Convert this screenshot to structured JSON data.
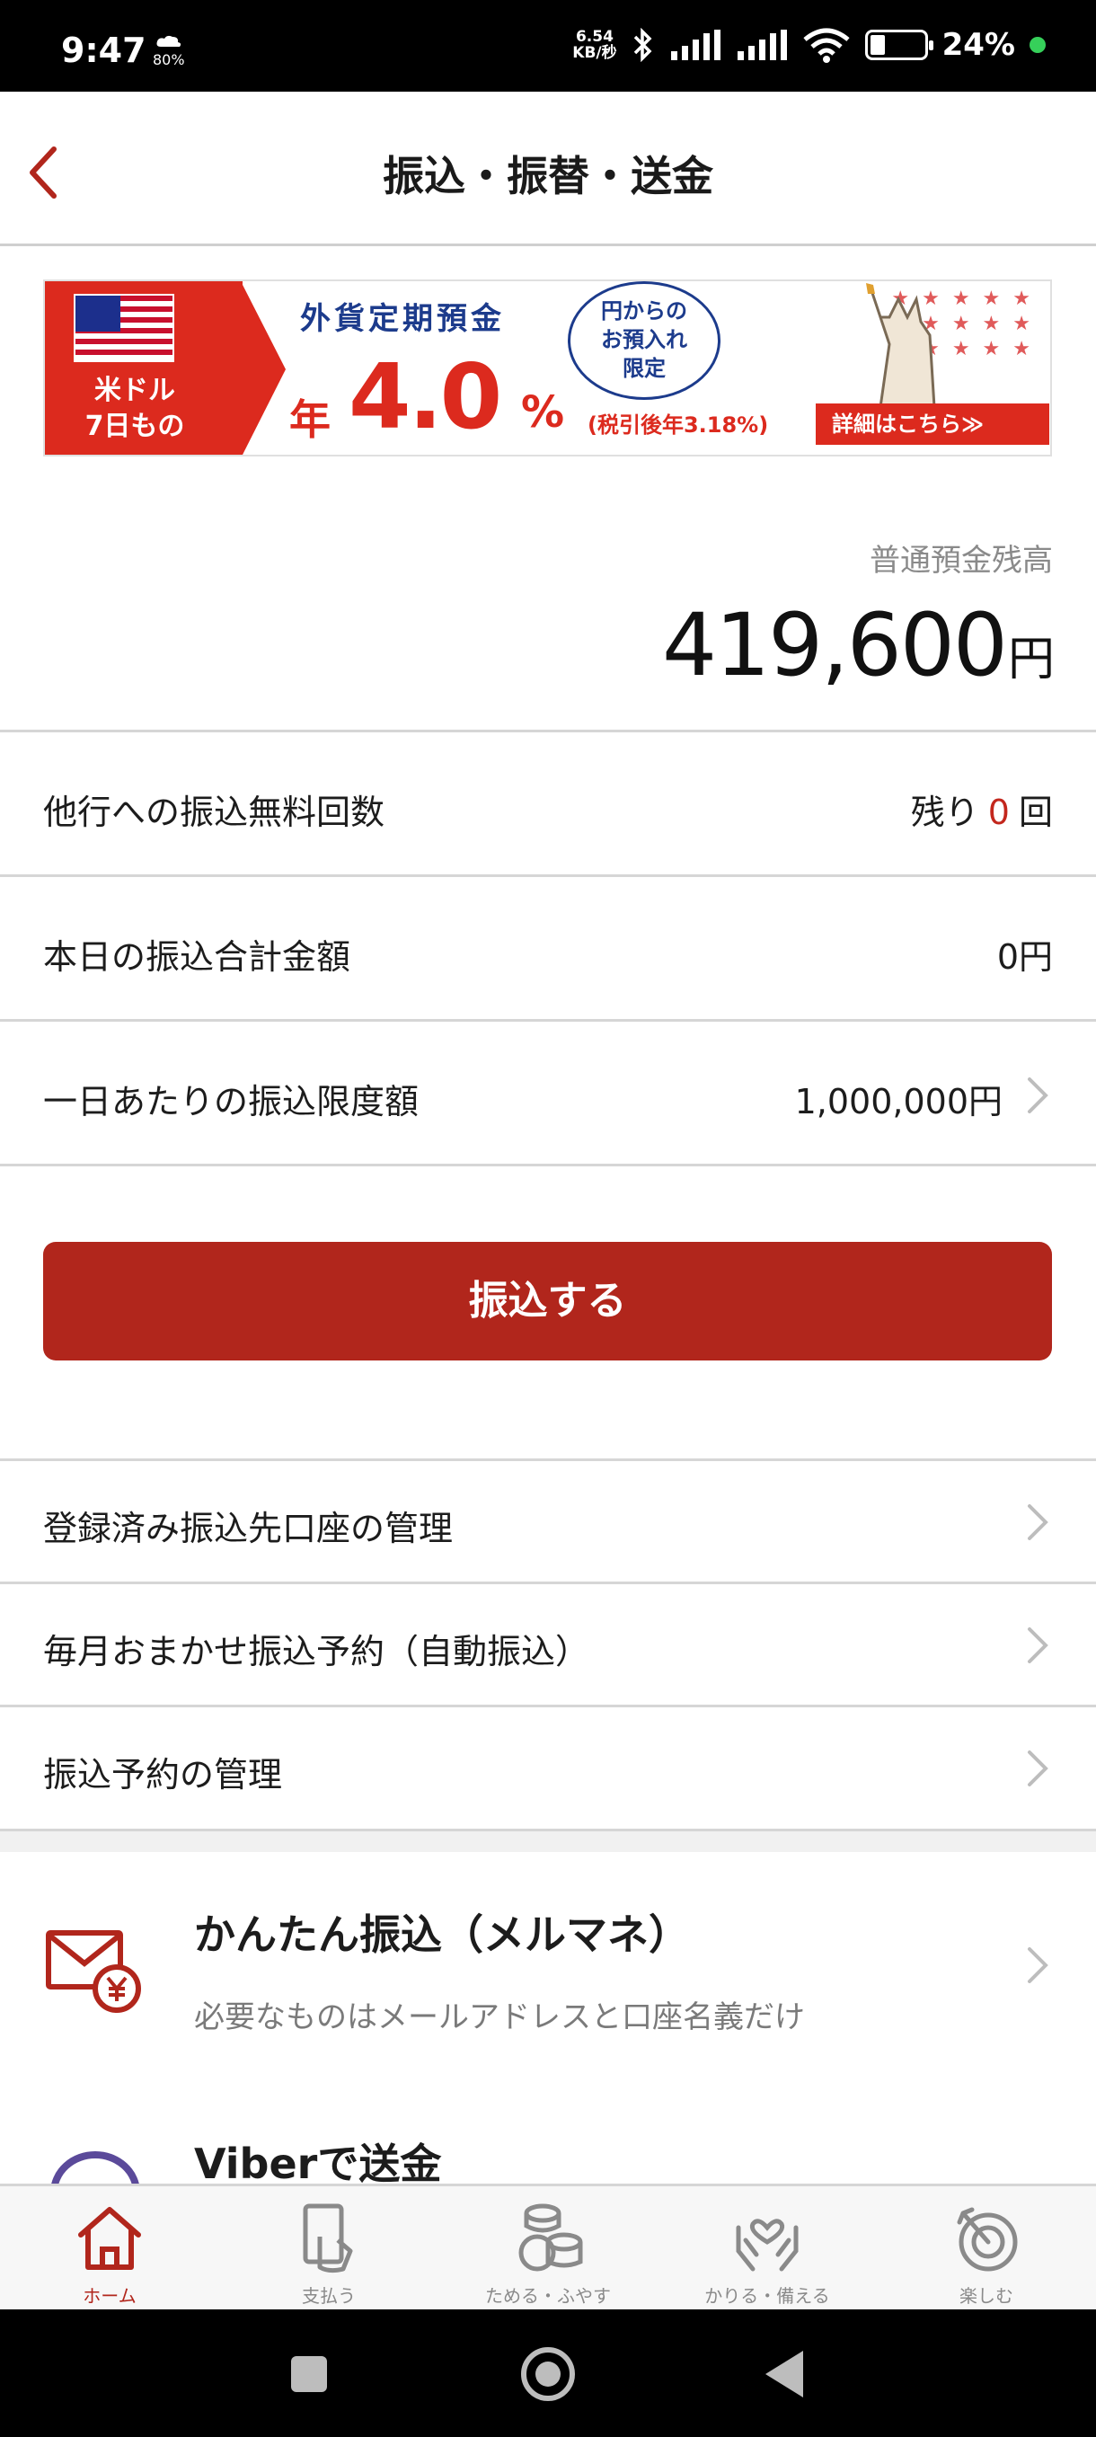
{
  "status_bar": {
    "time": "9:47",
    "cloud_percent": "80%",
    "net_speed_value": "6.54",
    "net_speed_unit": "KB/秒",
    "battery": "24%"
  },
  "header": {
    "title": "振込・振替・送金"
  },
  "banner": {
    "left_label_line1": "米ドル",
    "left_label_line2": "7日もの",
    "heading": "外貨定期預金",
    "rate_prefix": "年",
    "rate": "4.0",
    "rate_unit": "%",
    "bubble_line1": "円からの",
    "bubble_line2": "お預入れ",
    "bubble_line3": "限定",
    "tax_note": "(税引後年3.18%)",
    "detail_button": "詳細はこちら≫"
  },
  "balance": {
    "label": "普通預金残高",
    "amount": "419,600",
    "unit": "円"
  },
  "info_rows": {
    "free_transfers": {
      "label": "他行への振込無料回数",
      "prefix": "残り",
      "count": "0",
      "suffix": "回"
    },
    "today_total": {
      "label": "本日の振込合計金額",
      "value": "0円"
    },
    "daily_limit": {
      "label": "一日あたりの振込限度額",
      "value": "1,000,000円"
    }
  },
  "transfer_button": "振込する",
  "menu": {
    "registered_accounts": "登録済み振込先口座の管理",
    "monthly_auto": "毎月おまかせ振込予約（自動振込）",
    "reservations": "振込予約の管理"
  },
  "features": {
    "mailmane": {
      "title": "かんたん振込（メルマネ）",
      "subtitle": "必要なものはメールアドレスと口座名義だけ"
    },
    "viber": {
      "title": "Viberで送金"
    }
  },
  "bottom_nav": {
    "home": "ホーム",
    "pay": "支払う",
    "save": "ためる・ふやす",
    "borrow": "かりる・備える",
    "enjoy": "楽しむ"
  },
  "colors": {
    "brand_red": "#b1261c",
    "banner_red": "#dc2a1e",
    "banner_blue": "#1c3b8c"
  }
}
